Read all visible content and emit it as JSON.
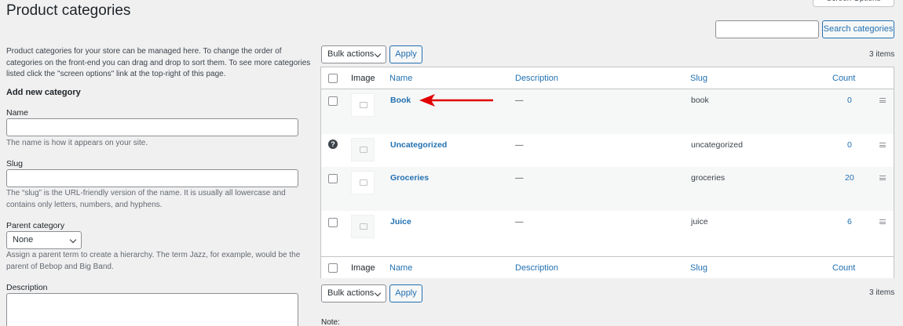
{
  "page": {
    "title": "Product categories",
    "screen_options_label": "Screen Options"
  },
  "search": {
    "value": "",
    "button_label": "Search categories"
  },
  "intro_text": "Product categories for your store can be managed here. To change the order of categories on the front-end you can drag and drop to sort them. To see more categories listed click the \"screen options\" link at the top-right of this page.",
  "form": {
    "heading": "Add new category",
    "name": {
      "label": "Name",
      "value": "",
      "help": "The name is how it appears on your site."
    },
    "slug": {
      "label": "Slug",
      "value": "",
      "help": "The “slug” is the URL-friendly version of the name. It is usually all lowercase and contains only letters, numbers, and hyphens."
    },
    "parent": {
      "label": "Parent category",
      "selected": "None",
      "help": "Assign a parent term to create a hierarchy. The term Jazz, for example, would be the parent of Bebop and Big Band."
    },
    "description": {
      "label": "Description",
      "value": ""
    }
  },
  "bulk": {
    "select_label": "Bulk actions",
    "apply_label": "Apply",
    "items_count": "3 items"
  },
  "table": {
    "columns": {
      "image": "Image",
      "name": "Name",
      "description": "Description",
      "slug": "Slug",
      "count": "Count"
    },
    "rows": [
      {
        "name": "Book",
        "description": "—",
        "slug": "book",
        "count": "0",
        "has_checkbox": true
      },
      {
        "name": "Uncategorized",
        "description": "—",
        "slug": "uncategorized",
        "count": "0",
        "has_checkbox": false
      },
      {
        "name": "Groceries",
        "description": "—",
        "slug": "groceries",
        "count": "20",
        "has_checkbox": true
      },
      {
        "name": "Juice",
        "description": "—",
        "slug": "juice",
        "count": "6",
        "has_checkbox": true
      }
    ]
  },
  "note_label": "Note:",
  "colors": {
    "link": "#2271b1",
    "annotation_arrow": "#e00000",
    "background": "#f0f0f1"
  }
}
